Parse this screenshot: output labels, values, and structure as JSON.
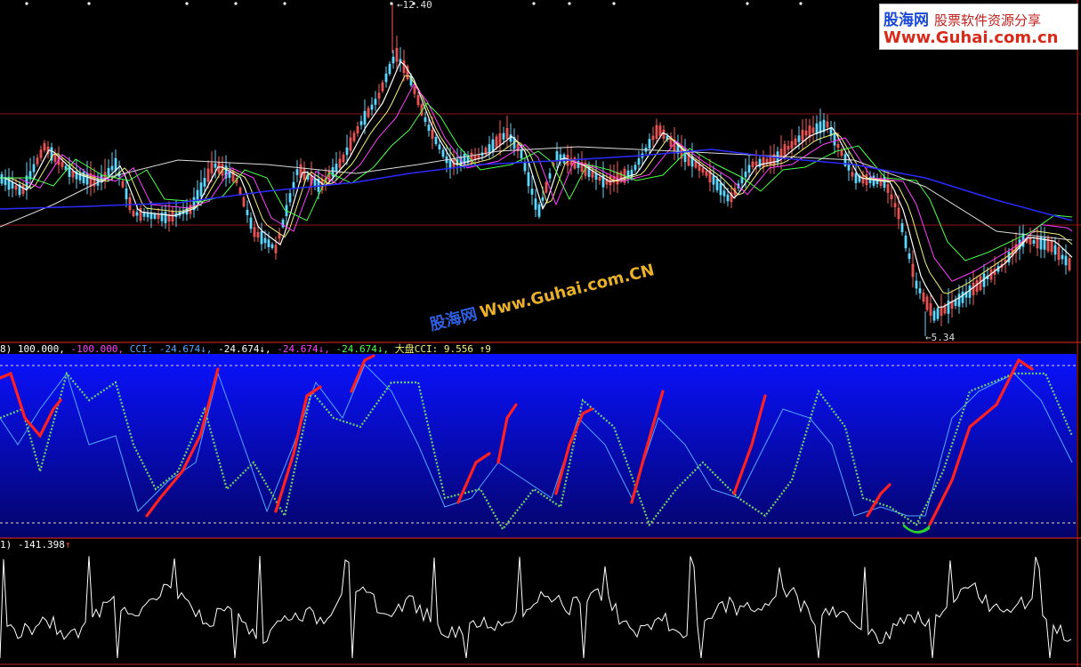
{
  "colors": {
    "bg": "#000000",
    "panel_border": "#c0201e",
    "candle_up": "#ff5a5a",
    "candle_down": "#5ad8ff",
    "ma_white": "#ffffff",
    "ma_yellow": "#f2f27a",
    "ma_magenta": "#ff40ff",
    "ma_green": "#4cff4c",
    "ma_blue": "#2b2bff",
    "ma_gray": "#dcdcdc",
    "cci_red": "#ff2020",
    "cci_blue": "#54a8ff",
    "cci_green": "#6fd16f",
    "osc_line": "#ffffff",
    "white_text": "#ffffff",
    "magenta_text": "#ff40ff",
    "blue_text": "#54a8ff",
    "green_text": "#4cff4c",
    "yellow_text": "#f2f27a",
    "red_text": "#ff4040"
  },
  "main_chart": {
    "high_label": "←12.40",
    "low_label": "←5.34",
    "high_price": 12.4,
    "low_price": 5.34
  },
  "cci_panel": {
    "header": {
      "prefix": "8)",
      "upper": "100.000,",
      "lower": "-100.000,",
      "cci_name": "CCI:",
      "cci_value": "-24.674↓,",
      "v2": "-24.674↓,",
      "v3": "-24.674↓,",
      "v4": "-24.674↓,",
      "dapan_label": "大盘CCI:",
      "dapan_value": "9.556",
      "tail": "↑9"
    },
    "upper_level": 100,
    "lower_level": -100
  },
  "osc_panel": {
    "header": {
      "prefix": "1)",
      "value": "-141.398",
      "arrow": "↑"
    }
  },
  "logo": {
    "name": "股海网",
    "tagline": "股票软件资源分享",
    "url": "Www.Guhai.com.cn"
  },
  "watermark": {
    "name": "股海网",
    "url": "Www.Guhai.com.CN"
  },
  "chart_data": [
    {
      "type": "candlestick",
      "title": "",
      "note": "price panel with moving averages; only extreme prices are printed",
      "high": 12.4,
      "low": 5.34
    },
    {
      "type": "line",
      "title": "",
      "note": "CCI indicator panel with upper/lower reference levels",
      "levels": [
        100,
        -100
      ],
      "last_values": [
        -24.674,
        -24.674,
        -24.674,
        -24.674
      ],
      "market_cci": 9.556
    },
    {
      "type": "line",
      "title": "",
      "note": "oscillator panel",
      "last_value": -141.398
    }
  ]
}
